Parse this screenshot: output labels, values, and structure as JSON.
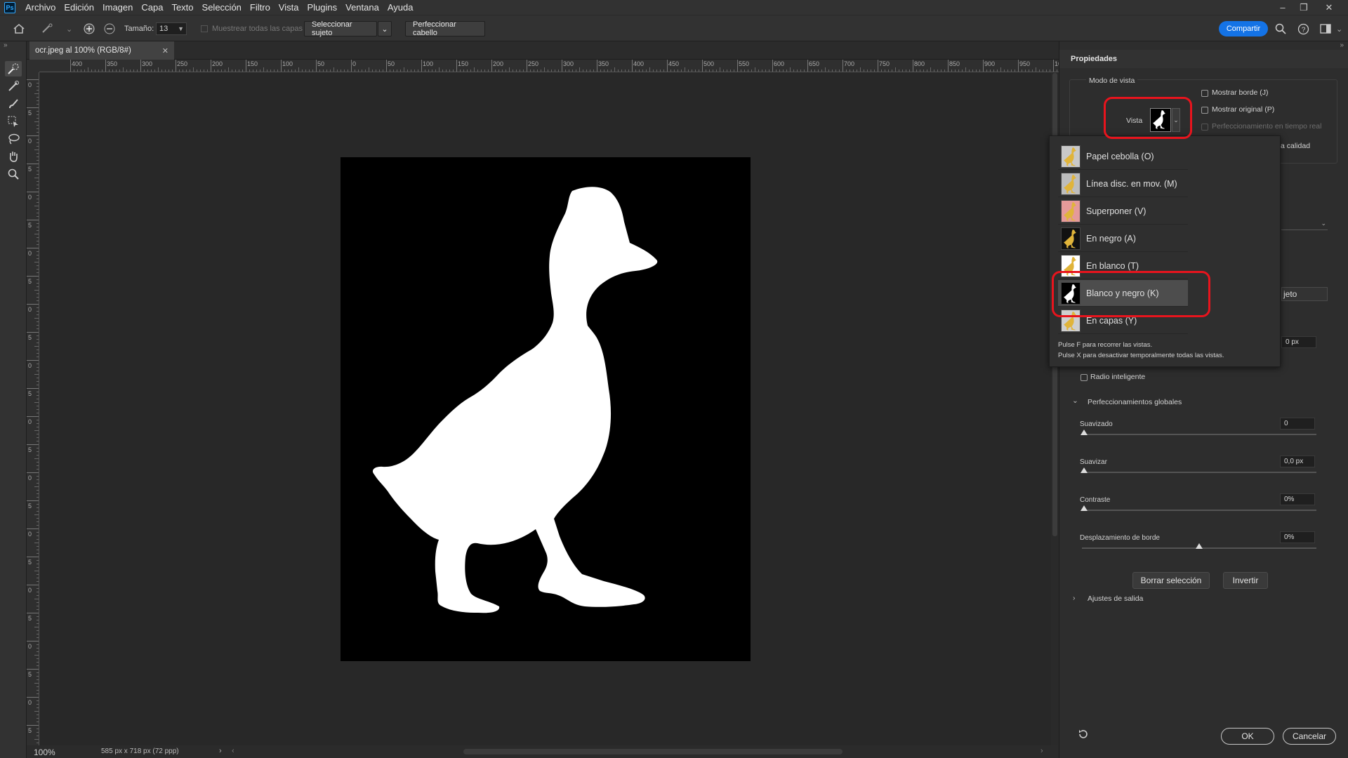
{
  "app": {
    "logo": "Ps"
  },
  "menubar": [
    "Archivo",
    "Edición",
    "Imagen",
    "Capa",
    "Texto",
    "Selección",
    "Filtro",
    "Vista",
    "Plugins",
    "Ventana",
    "Ayuda"
  ],
  "options": {
    "size_label": "Tamaño:",
    "size_value": "13",
    "sample_all_label": "Muestrear todas las capas",
    "select_subject": "Seleccionar sujeto",
    "refine_hair": "Perfeccionar cabello",
    "share": "Compartir"
  },
  "document": {
    "tab_title": "ocr.jpeg al 100% (RGB/8#)",
    "zoom": "100%",
    "info": "585 px x 718 px (72 ppp)"
  },
  "ruler": {
    "h_labels": [
      "400",
      "350",
      "300",
      "250",
      "200",
      "150",
      "100",
      "50",
      "0",
      "50",
      "100",
      "150",
      "200",
      "250",
      "300",
      "350",
      "400",
      "450",
      "500",
      "550",
      "600",
      "650",
      "700",
      "750",
      "800",
      "850",
      "900",
      "950",
      "10"
    ],
    "v_labels": [
      "0",
      "5",
      "0",
      "5",
      "0",
      "5",
      "0",
      "5",
      "0",
      "5",
      "0",
      "5",
      "0",
      "5",
      "0",
      "5",
      "0",
      "5",
      "0",
      "5",
      "0",
      "5",
      "0",
      "5"
    ]
  },
  "panel": {
    "title": "Propiedades",
    "view_mode": "Modo de vista",
    "view_label": "Vista",
    "show_edge": "Mostrar borde (J)",
    "show_original": "Mostrar original (P)",
    "realtime": "Perfeccionamiento en tiempo real",
    "high_quality_partial": "a calidad",
    "subject_partial": "jeto",
    "radius_value": "0 px",
    "smart_radius": "Radio inteligente",
    "global_refinements": "Perfeccionamientos globales",
    "sliders": [
      {
        "label": "Suavizado",
        "value": "0",
        "level": 0
      },
      {
        "label": "Suavizar",
        "value": "0,0 px",
        "level": 0
      },
      {
        "label": "Contraste",
        "value": "0%",
        "level": 0
      },
      {
        "label": "Desplazamiento de borde",
        "value": "0%",
        "level": 0.5
      }
    ],
    "clear_selection": "Borrar selección",
    "invert": "Invertir",
    "output_settings": "Ajustes de salida",
    "ok": "OK",
    "cancel": "Cancelar"
  },
  "view_dropdown": {
    "items": [
      {
        "label": "Papel cebolla (O)",
        "thumb": "onion"
      },
      {
        "label": "Línea disc. en mov. (M)",
        "thumb": "marching"
      },
      {
        "label": "Superponer (V)",
        "thumb": "overlay"
      },
      {
        "label": "En negro (A)",
        "thumb": "onblack"
      },
      {
        "label": "En blanco (T)",
        "thumb": "onwhite"
      },
      {
        "label": "Blanco y negro (K)",
        "thumb": "bw",
        "selected": true
      },
      {
        "label": "En capas (Y)",
        "thumb": "layers"
      }
    ],
    "hint1": "Pulse F para recorrer las vistas.",
    "hint2": "Pulse X para desactivar temporalmente todas las vistas."
  },
  "colors": {
    "accent": "#1473e6",
    "highlight": "#e8141d"
  }
}
